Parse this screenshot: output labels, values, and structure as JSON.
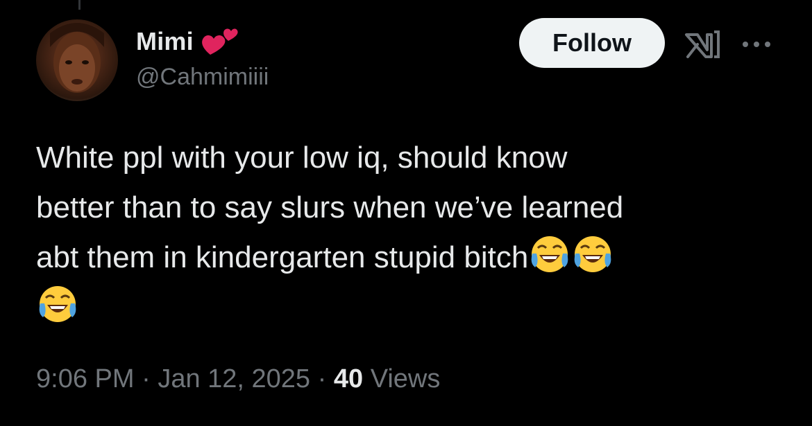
{
  "tweet": {
    "author": {
      "display_name": "Mimi",
      "name_emoji": "two-hearts-icon",
      "handle": "@Cahmimiiii",
      "avatar": "profile-photo"
    },
    "follow_label": "Follow",
    "grok_icon": "grok-icon",
    "more_icon": "more-options-icon",
    "text_line_1": "White ppl with your low iq, should know",
    "text_line_2": "better than to say slurs when we’ve learned",
    "text_line_3": "abt them in kindergarten stupid bitch",
    "emoji": "face-with-tears-of-joy",
    "emoji_count": 3,
    "time": "9:06 PM",
    "separator": "·",
    "date": "Jan 12, 2025",
    "views_count": "40",
    "views_label": "Views"
  },
  "colors": {
    "background": "#000000",
    "text_primary": "#e7e9ea",
    "text_secondary": "#71767b",
    "follow_bg": "#eff3f4",
    "follow_text": "#0f1419",
    "heart": "#e0245e"
  }
}
